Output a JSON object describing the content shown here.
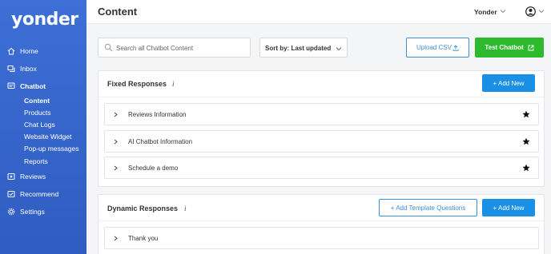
{
  "app": {
    "logo": "yonder"
  },
  "sidebar": {
    "items": [
      {
        "label": "Home",
        "icon": "home-icon"
      },
      {
        "label": "Inbox",
        "icon": "inbox-icon"
      },
      {
        "label": "Chatbot",
        "icon": "chat-icon"
      },
      {
        "label": "Reviews",
        "icon": "reviews-icon"
      },
      {
        "label": "Recommend",
        "icon": "recommend-icon"
      },
      {
        "label": "Settings",
        "icon": "gear-icon"
      }
    ],
    "chatbot_subitems": [
      "Content",
      "Products",
      "Chat Logs",
      "Website Widget",
      "Pop-up messages",
      "Reports"
    ],
    "active_subitem": "Content"
  },
  "header": {
    "title": "Content",
    "account": "Yonder"
  },
  "toolbar": {
    "search_placeholder": "Search all Chatbot Content",
    "sort_label": "Sort by: Last updated",
    "upload_label": "Upload CSV",
    "test_label": "Test Chatbot"
  },
  "fixed": {
    "title": "Fixed Responses",
    "info": "i",
    "add_label": "+ Add New",
    "rows": [
      "Reviews Information",
      "AI Chatbot Information",
      "Schedule a demo"
    ]
  },
  "dynamic": {
    "title": "Dynamic Responses",
    "info": "i",
    "add_template_label": "+ Add Template Questions",
    "add_label": "+ Add New",
    "rows": [
      "Thank you"
    ]
  },
  "colors": {
    "sidebar": "#3d6fd6",
    "primary": "#1a8fe6",
    "success": "#2dbb2d",
    "outline": "#3b8fd9"
  }
}
